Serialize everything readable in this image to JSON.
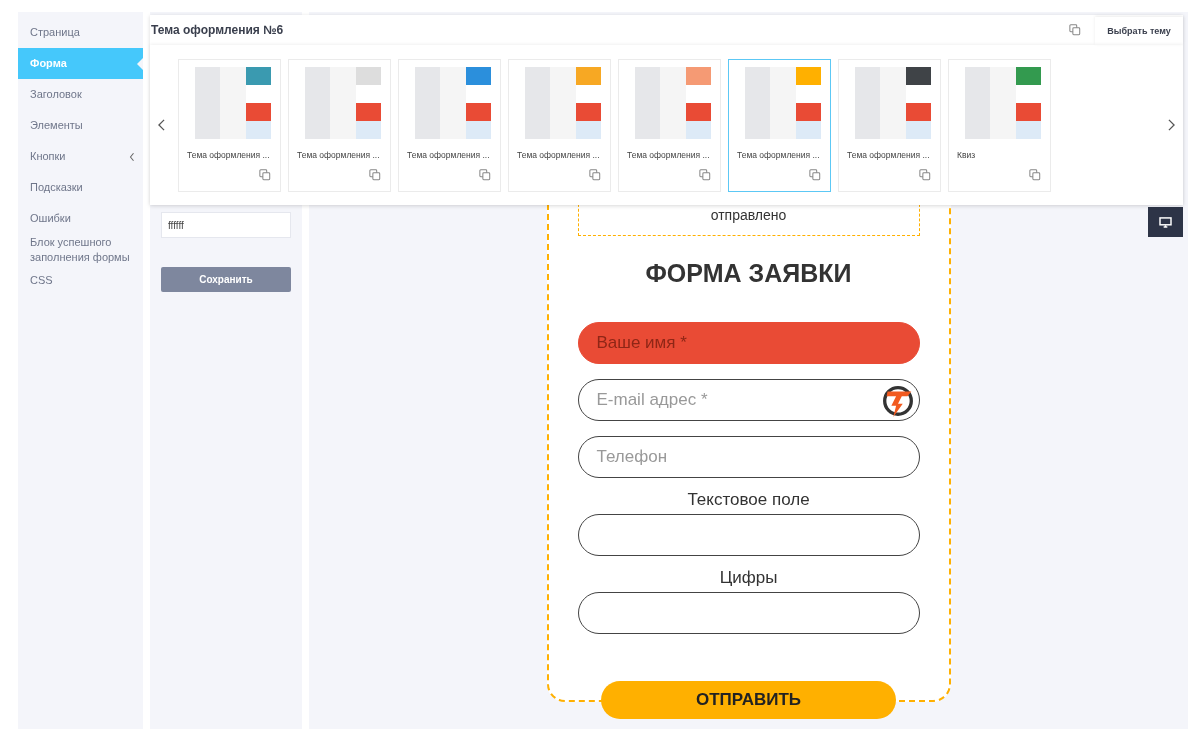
{
  "sidebar": {
    "items": [
      {
        "label": "Страница",
        "kind": "link",
        "selected": false
      },
      {
        "label": "Форма",
        "kind": "link",
        "selected": true
      },
      {
        "label": "Заголовок",
        "kind": "link",
        "selected": false
      },
      {
        "label": "Элементы",
        "kind": "link",
        "selected": false
      },
      {
        "label": "Кнопки",
        "kind": "group",
        "selected": false
      },
      {
        "label": "Подсказки",
        "kind": "link",
        "selected": false
      },
      {
        "label": "Ошибки",
        "kind": "link",
        "selected": false
      },
      {
        "label": "Блок успешного заполнения формы",
        "kind": "link",
        "selected": false
      },
      {
        "label": "CSS",
        "kind": "link",
        "selected": false
      }
    ]
  },
  "settings": {
    "color_value": "ffffff",
    "save_button": "Сохранить"
  },
  "theme_picker": {
    "title": "Тема оформления №6",
    "choose_tab": "Выбрать тему",
    "themes": [
      {
        "name": "Тема оформления ...",
        "color": "#3a9ab0",
        "selected": false
      },
      {
        "name": "Тема оформления ...",
        "color": "#dddddd",
        "selected": false
      },
      {
        "name": "Тема оформления ...",
        "color": "#2b8fdc",
        "selected": false
      },
      {
        "name": "Тема оформления ...",
        "color": "#f7a823",
        "selected": false
      },
      {
        "name": "Тема оформления ...",
        "color": "#f59a74",
        "selected": false
      },
      {
        "name": "Тема оформления ...",
        "color": "#ffb000",
        "selected": true
      },
      {
        "name": "Тема оформления ...",
        "color": "#3f4347",
        "selected": false
      },
      {
        "name": "Квиз",
        "color": "#339a4f",
        "selected": false
      }
    ]
  },
  "form_preview": {
    "success_text": "отправлено",
    "title": "ФОРМА ЗАЯВКИ",
    "fields": [
      {
        "placeholder": "Ваше имя *",
        "error": true
      },
      {
        "placeholder": "E-mail адрес *",
        "error": false
      },
      {
        "placeholder": "Телефон",
        "error": false
      },
      {
        "label": "Текстовое поле",
        "error": false
      },
      {
        "label": "Цифры",
        "error": false
      }
    ],
    "submit": "ОТПРАВИТЬ"
  }
}
